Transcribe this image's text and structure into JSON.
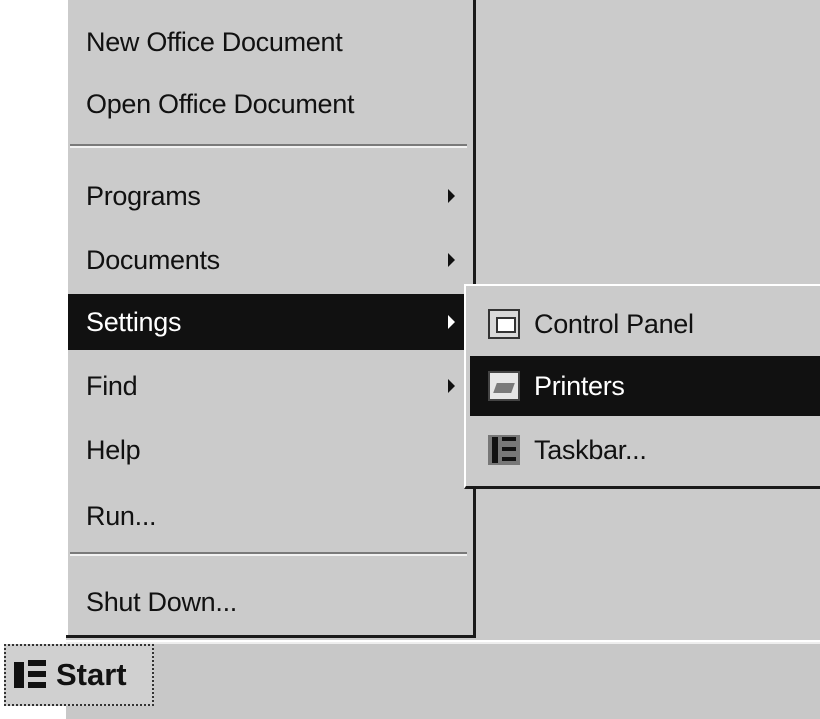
{
  "start_menu": {
    "items": [
      {
        "label": "New Office Document",
        "has_submenu": false,
        "selected": false
      },
      {
        "label": "Open Office Document",
        "has_submenu": false,
        "selected": false
      },
      {
        "label": "Programs",
        "has_submenu": true,
        "selected": false
      },
      {
        "label": "Documents",
        "has_submenu": true,
        "selected": false
      },
      {
        "label": "Settings",
        "has_submenu": true,
        "selected": true
      },
      {
        "label": "Find",
        "has_submenu": true,
        "selected": false
      },
      {
        "label": "Help",
        "has_submenu": false,
        "selected": false
      },
      {
        "label": "Run...",
        "has_submenu": false,
        "selected": false
      },
      {
        "label": "Shut Down...",
        "has_submenu": false,
        "selected": false
      }
    ]
  },
  "settings_submenu": {
    "items": [
      {
        "label": "Control Panel",
        "icon": "control-panel-icon",
        "selected": false
      },
      {
        "label": "Printers",
        "icon": "printers-icon",
        "selected": true
      },
      {
        "label": "Taskbar...",
        "icon": "taskbar-icon",
        "selected": false
      }
    ]
  },
  "taskbar": {
    "start_label": "Start"
  },
  "colors": {
    "menu_bg": "#cbcbcb",
    "highlight_bg": "#111111",
    "highlight_text": "#ffffff",
    "text": "#111111"
  }
}
